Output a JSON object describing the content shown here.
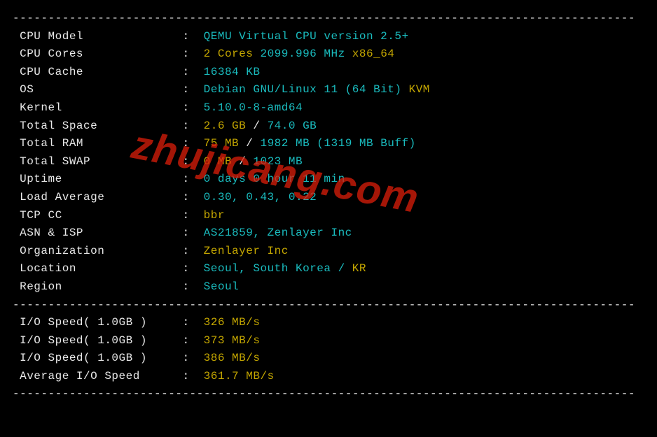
{
  "sysinfo": [
    {
      "label": "CPU Model",
      "parts": [
        {
          "text": "QEMU Virtual CPU version 2.5+",
          "cls": "cyan"
        }
      ]
    },
    {
      "label": "CPU Cores",
      "parts": [
        {
          "text": "2 Cores",
          "cls": "yellow"
        },
        {
          "text": " 2099.996 MHz ",
          "cls": "cyan"
        },
        {
          "text": "x86_64",
          "cls": "yellow"
        }
      ]
    },
    {
      "label": "CPU Cache",
      "parts": [
        {
          "text": "16384 KB",
          "cls": "cyan"
        }
      ]
    },
    {
      "label": "OS",
      "parts": [
        {
          "text": "Debian GNU/Linux 11 (64 Bit)",
          "cls": "cyan"
        },
        {
          "text": " KVM",
          "cls": "yellow"
        }
      ]
    },
    {
      "label": "Kernel",
      "parts": [
        {
          "text": "5.10.0-8-amd64",
          "cls": "cyan"
        }
      ]
    },
    {
      "label": "Total Space",
      "parts": [
        {
          "text": "2.6 GB",
          "cls": "yellow"
        },
        {
          "text": " / ",
          "cls": "white"
        },
        {
          "text": "74.0 GB",
          "cls": "cyan"
        }
      ]
    },
    {
      "label": "Total RAM",
      "parts": [
        {
          "text": "75 MB",
          "cls": "yellow"
        },
        {
          "text": " / ",
          "cls": "white"
        },
        {
          "text": "1982 MB",
          "cls": "cyan"
        },
        {
          "text": " (1319 MB Buff)",
          "cls": "cyan"
        }
      ]
    },
    {
      "label": "Total SWAP",
      "parts": [
        {
          "text": "0 MB",
          "cls": "yellow"
        },
        {
          "text": " / ",
          "cls": "white"
        },
        {
          "text": "1023 MB",
          "cls": "cyan"
        }
      ]
    },
    {
      "label": "Uptime",
      "parts": [
        {
          "text": "0 days 0 hour 11 min",
          "cls": "cyan"
        }
      ]
    },
    {
      "label": "Load Average",
      "parts": [
        {
          "text": "0.30, 0.43, 0.22",
          "cls": "cyan"
        }
      ]
    },
    {
      "label": "TCP CC",
      "parts": [
        {
          "text": "bbr",
          "cls": "yellow"
        }
      ]
    },
    {
      "label": "ASN & ISP",
      "parts": [
        {
          "text": "AS21859, Zenlayer Inc",
          "cls": "cyan"
        }
      ]
    },
    {
      "label": "Organization",
      "parts": [
        {
          "text": "Zenlayer Inc",
          "cls": "yellow"
        }
      ]
    },
    {
      "label": "Location",
      "parts": [
        {
          "text": "Seoul, South Korea / ",
          "cls": "cyan"
        },
        {
          "text": "KR",
          "cls": "yellow"
        }
      ]
    },
    {
      "label": "Region",
      "parts": [
        {
          "text": "Seoul",
          "cls": "cyan"
        }
      ]
    }
  ],
  "iospeed": [
    {
      "label": "I/O Speed( 1.0GB )",
      "parts": [
        {
          "text": "326 MB/s",
          "cls": "yellow"
        }
      ]
    },
    {
      "label": "I/O Speed( 1.0GB )",
      "parts": [
        {
          "text": "373 MB/s",
          "cls": "yellow"
        }
      ]
    },
    {
      "label": "I/O Speed( 1.0GB )",
      "parts": [
        {
          "text": "386 MB/s",
          "cls": "yellow"
        }
      ]
    },
    {
      "label": "Average I/O Speed",
      "parts": [
        {
          "text": "361.7 MB/s",
          "cls": "yellow"
        }
      ]
    }
  ],
  "dashline": "----------------------------------------------------------------------------------------",
  "watermark": "zhujicang.com"
}
